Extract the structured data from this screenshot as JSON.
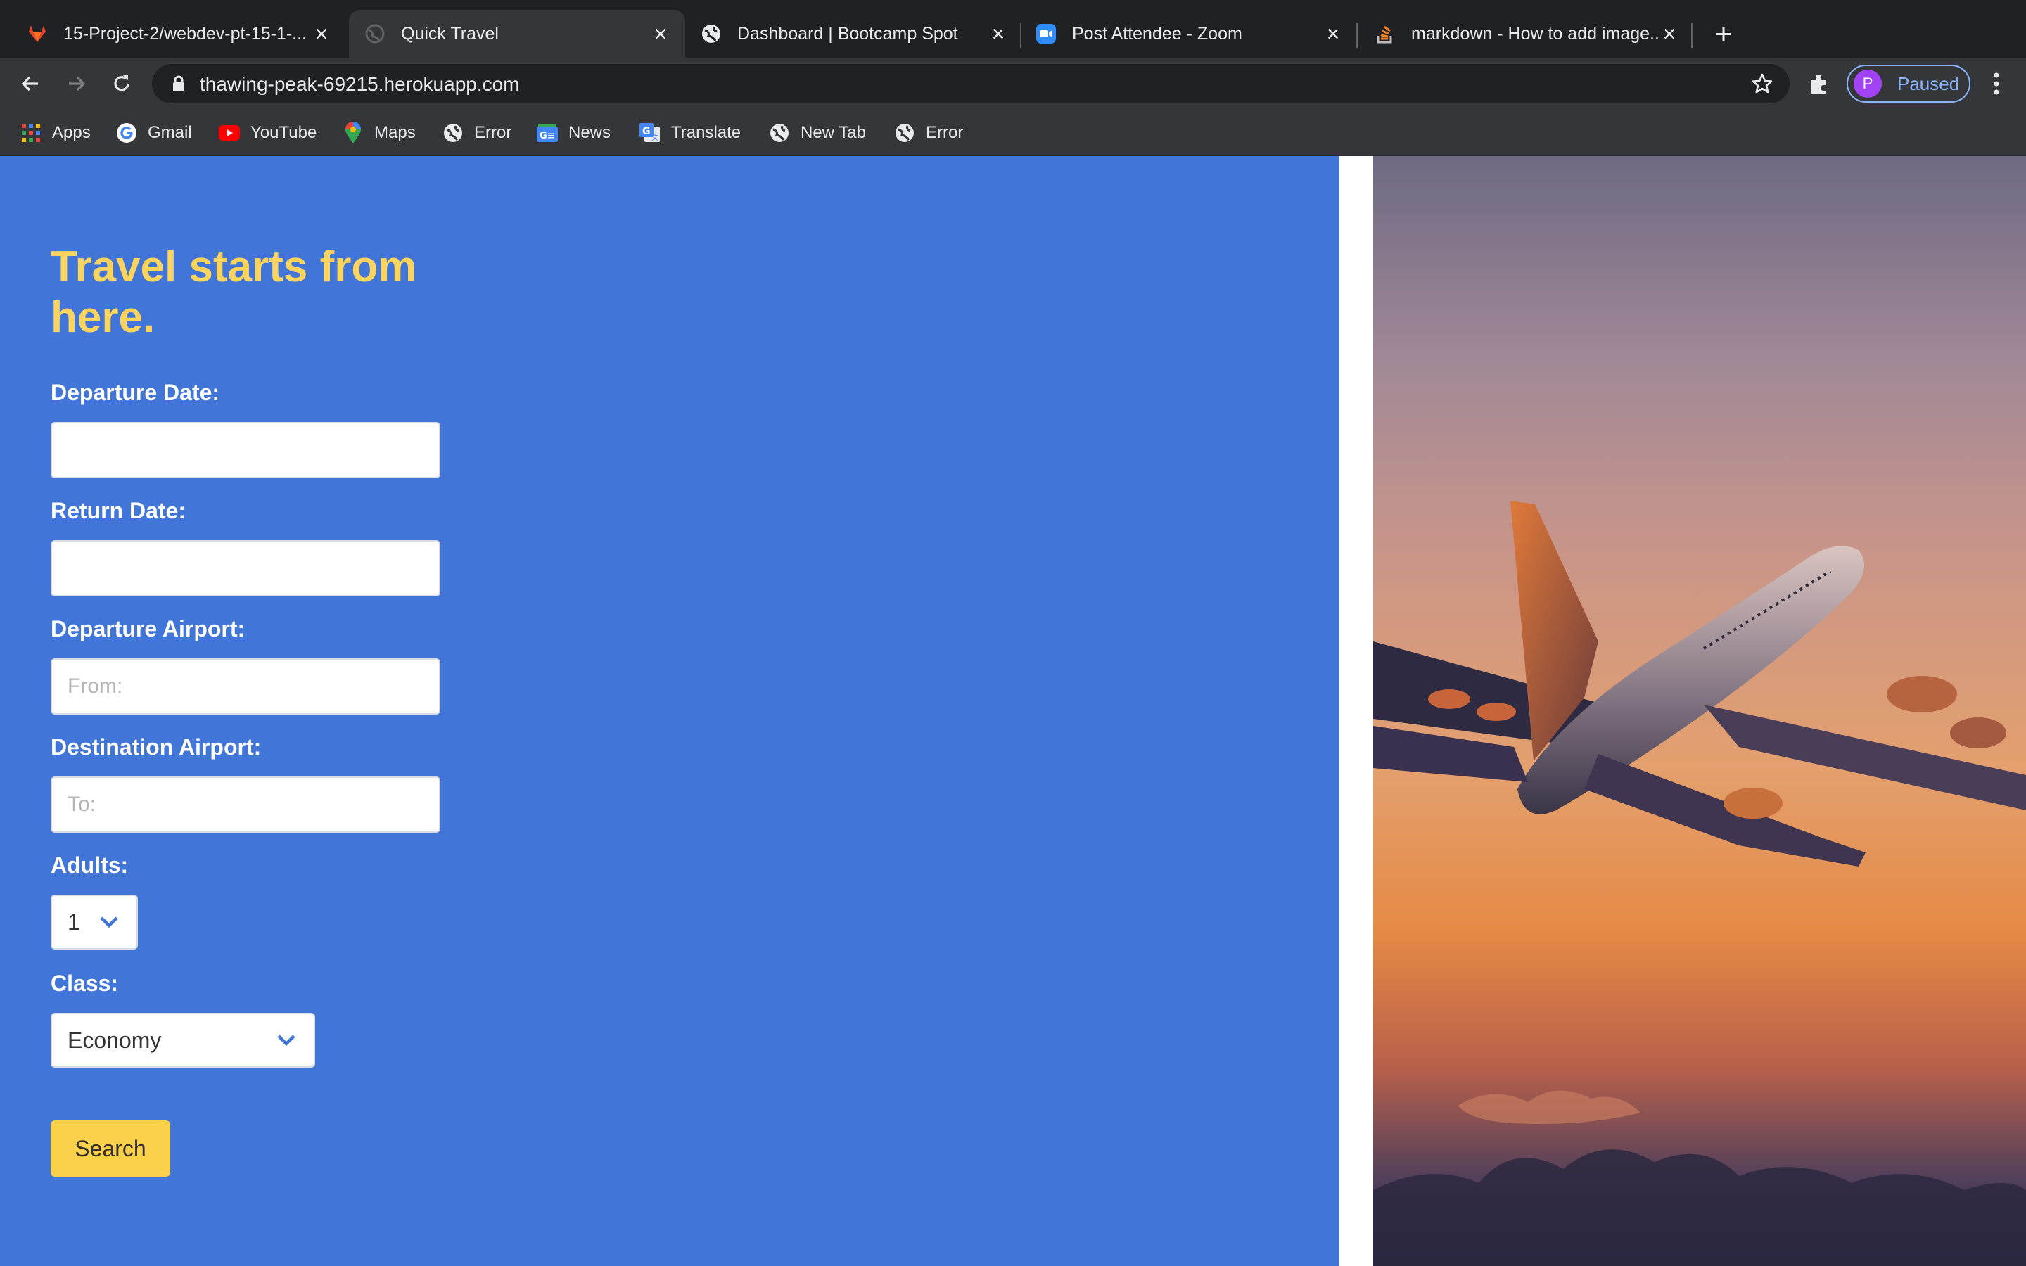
{
  "tabs": [
    {
      "title": "15-Project-2/webdev-pt-15-1-...",
      "favicon": "gitlab-icon",
      "active": false
    },
    {
      "title": "Quick Travel",
      "favicon": "globe-icon",
      "active": true
    },
    {
      "title": "Dashboard | Bootcamp Spot",
      "favicon": "globe-icon",
      "active": false
    },
    {
      "title": "Post Attendee - Zoom",
      "favicon": "zoom-icon",
      "active": false
    },
    {
      "title": "markdown - How to add image...",
      "favicon": "stackoverflow-icon",
      "active": false
    }
  ],
  "address_bar": {
    "url": "thawing-peak-69215.herokuapp.com"
  },
  "profile": {
    "initial": "P",
    "label": "Paused"
  },
  "bookmarks": [
    {
      "label": "Apps",
      "icon": "apps-grid-icon"
    },
    {
      "label": "Gmail",
      "icon": "google-icon"
    },
    {
      "label": "YouTube",
      "icon": "youtube-icon"
    },
    {
      "label": "Maps",
      "icon": "maps-icon"
    },
    {
      "label": "Error",
      "icon": "globe-icon"
    },
    {
      "label": "News",
      "icon": "news-icon"
    },
    {
      "label": "Translate",
      "icon": "translate-icon"
    },
    {
      "label": "New Tab",
      "icon": "globe-icon"
    },
    {
      "label": "Error",
      "icon": "globe-icon"
    }
  ],
  "form": {
    "heading": "Travel starts from here.",
    "departure_date_label": "Departure Date:",
    "departure_date_value": "",
    "return_date_label": "Return Date:",
    "return_date_value": "",
    "departure_airport_label": "Departure Airport:",
    "departure_airport_placeholder": "From:",
    "destination_airport_label": "Destination Airport:",
    "destination_airport_placeholder": "To:",
    "adults_label": "Adults:",
    "adults_value": "1",
    "class_label": "Class:",
    "class_value": "Economy",
    "search_label": "Search"
  },
  "colors": {
    "panel_bg": "#4275d8",
    "heading": "#fbd45e",
    "button_bg": "#fbd04b",
    "chevron": "#4275d8"
  }
}
